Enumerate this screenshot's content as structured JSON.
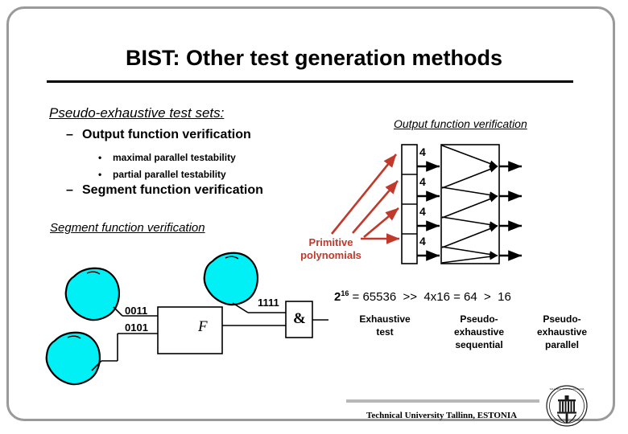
{
  "slide": {
    "title": "BIST: Other test generation methods"
  },
  "bullets": {
    "heading": "Pseudo-exhaustive test sets:",
    "level1_a": "Output function verification",
    "level2_a": "maximal parallel testability",
    "level2_b": "partial parallel testability",
    "level1_b": "Segment function verification",
    "dash": "–",
    "dot": "•"
  },
  "captions": {
    "segment": "Segment function verification",
    "output": "Output function verification"
  },
  "primitive": {
    "line1": "Primitive",
    "line2": "polynomials",
    "color": "#c0392b"
  },
  "register": {
    "bus_labels": [
      "4",
      "4",
      "4",
      "4"
    ]
  },
  "logic": {
    "input_top": "0011",
    "input_bottom": "0101",
    "mask": "1111",
    "function_label": "F",
    "gate_label": "&"
  },
  "comparison": {
    "expr_base": "2",
    "expr_exp": "16",
    "expr_rest": " = 65536",
    "op1": ">>",
    "term2": "4x16 = 64",
    "op2": ">",
    "term3": "16",
    "columns": [
      "Exhaustive\ntest",
      "Pseudo-\nexhaustive\nsequential",
      "Pseudo-\nexhaustive\nparallel"
    ]
  },
  "footer": {
    "text": "Technical University Tallinn, ESTONIA",
    "logo": "university-seal-icon"
  },
  "colors": {
    "accent_red": "#c0392b",
    "blob_cyan": "#00f0f5",
    "frame_gray": "#9a9a9a",
    "ink": "#000000"
  }
}
